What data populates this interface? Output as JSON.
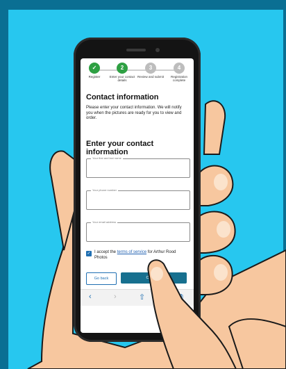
{
  "page": {
    "bg_outer": "#0a6f93",
    "bg_panel": "#27c7ef",
    "skin": "#f7c79f",
    "skin_shade": "#e9b185"
  },
  "stepper": {
    "steps": [
      {
        "label": "Register",
        "glyph": "✓",
        "state": "done"
      },
      {
        "label": "Enter your contact details",
        "glyph": "2",
        "state": "active"
      },
      {
        "label": "Review and submit",
        "glyph": "3",
        "state": "todo"
      },
      {
        "label": "Registration complete",
        "glyph": "4",
        "state": "todo"
      }
    ]
  },
  "content": {
    "title": "Contact information",
    "intro": "Please enter your contact information. We will notify you when the pictures are ready for you to view and order.",
    "section_title": "Enter your contact information"
  },
  "fields": {
    "name_placeholder": "Your first and last name",
    "phone_placeholder": "Your phone number",
    "email_placeholder": "Your email address"
  },
  "consent": {
    "checked_glyph": "✓",
    "prefix": "I accept the ",
    "link": "terms of service",
    "suffix": " for Arthur Rood Photos"
  },
  "buttons": {
    "back": "Go back",
    "continue": "Continue"
  },
  "browser": {
    "back_icon": "‹",
    "forward_icon": "›",
    "share_icon": "⇧",
    "tabs_icon": "⧉"
  },
  "colors": {
    "green": "#2ea043",
    "grey": "#bdbdbd",
    "blue": "#1f6fb2",
    "teal": "#17708f"
  }
}
